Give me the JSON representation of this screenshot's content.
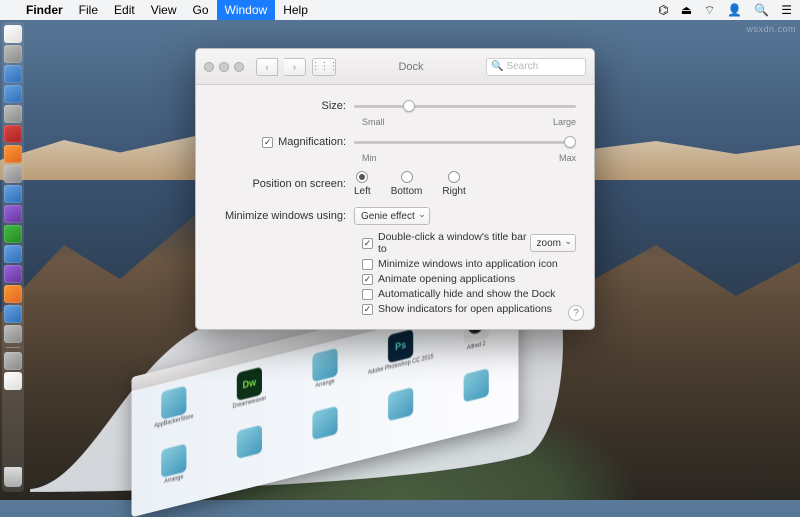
{
  "menubar": {
    "app": "Finder",
    "items": [
      "File",
      "Edit",
      "View",
      "Go",
      "Window",
      "Help"
    ],
    "active_index": 4
  },
  "watermark": "wsxdn.com",
  "prefs": {
    "title": "Dock",
    "search_placeholder": "Search",
    "size": {
      "label": "Size:",
      "min": "Small",
      "max": "Large",
      "value_pct": 22
    },
    "magnification": {
      "label": "Magnification:",
      "checked": true,
      "min": "Min",
      "max": "Max",
      "value_pct": 100
    },
    "position": {
      "label": "Position on screen:",
      "options": [
        "Left",
        "Bottom",
        "Right"
      ],
      "selected": 0
    },
    "minimize": {
      "label": "Minimize windows using:",
      "value": "Genie effect"
    },
    "dblclick": {
      "label_pre": "Double-click a window's title bar to",
      "value": "zoom",
      "checked": true
    },
    "checks": {
      "min_into_icon": {
        "label": "Minimize windows into application icon",
        "checked": false
      },
      "animate": {
        "label": "Animate opening applications",
        "checked": true
      },
      "autohide": {
        "label": "Automatically hide and show the Dock",
        "checked": false
      },
      "indicators": {
        "label": "Show indicators for open applications",
        "checked": true
      }
    }
  },
  "genie_apps": [
    {
      "name": "Adobe Photoshop CC 2015",
      "kind": "ps",
      "text": "Ps"
    },
    {
      "name": "Arrange",
      "kind": "plain"
    },
    {
      "name": "Dreamweaver",
      "kind": "dw",
      "text": "Dw"
    },
    {
      "name": "Alfred 2",
      "kind": "hat"
    },
    {
      "name": "AppBackerStore",
      "kind": "plain"
    }
  ]
}
